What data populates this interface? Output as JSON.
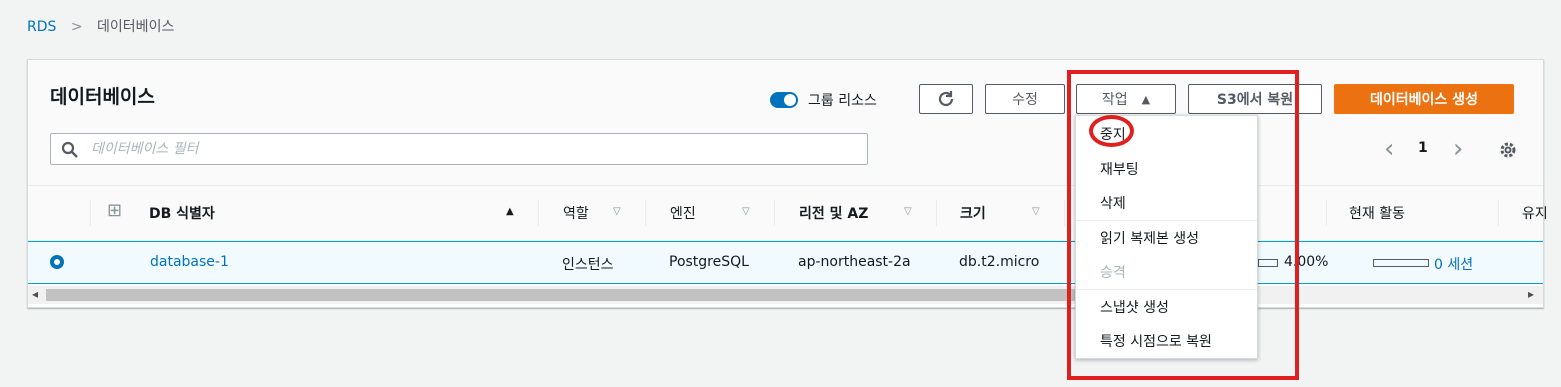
{
  "breadcrumb": {
    "root": "RDS",
    "separator": ">",
    "current": "데이터베이스"
  },
  "panel": {
    "title": "데이터베이스",
    "group_toggle": {
      "label": "그룹 리소스",
      "on": true
    },
    "buttons": {
      "refresh_icon": "refresh-icon",
      "modify": "수정",
      "actions": "작업",
      "actions_caret": "▲",
      "restore_s3": "S3에서 복원",
      "create": "데이터베이스 생성"
    },
    "filter": {
      "placeholder": "데이터베이스 필터"
    },
    "pager": {
      "page": "1",
      "prev": "‹",
      "next": "›"
    }
  },
  "table": {
    "headers": {
      "expand": "⊞",
      "db_id": "DB 식별자",
      "db_id_sort": "▲",
      "role": "역할",
      "engine": "엔진",
      "region": "리전 및 AZ",
      "size": "크기",
      "activity": "현재 활동",
      "maintenance": "유지",
      "filter_mark": "▽"
    },
    "rows": [
      {
        "db_id": "database-1",
        "role": "인스턴스",
        "engine": "PostgreSQL",
        "region": "ap-northeast-2a",
        "size": "db.t2.micro",
        "cpu": "4.00%",
        "activity": "0 세션"
      }
    ]
  },
  "scroll_arrows": {
    "left": "◂",
    "right": "▸"
  },
  "actions_menu": {
    "items": [
      "중지",
      "재부팅",
      "삭제",
      "읽기 복제본 생성",
      "승격",
      "스냅샷 생성",
      "특정 시점으로 복원"
    ],
    "disabled": [
      "승격"
    ]
  },
  "colors": {
    "link": "#0073bb",
    "primary": "#ec7211",
    "selected_row": "#f1faff",
    "annotation": "#e0201f"
  }
}
